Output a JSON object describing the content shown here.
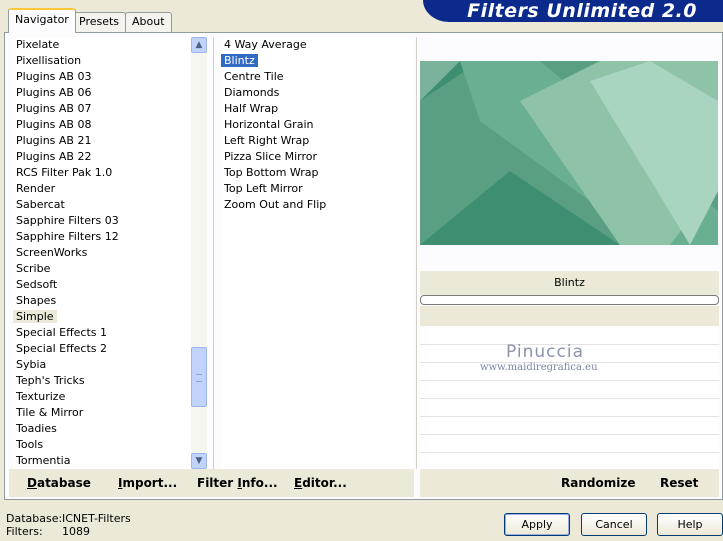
{
  "header": {
    "tabs": [
      "Navigator",
      "Presets",
      "About"
    ],
    "active_tab": "Navigator",
    "brand": "Filters Unlimited 2.0"
  },
  "categories": {
    "items": [
      "Pixelate",
      "Pixellisation",
      "Plugins AB 03",
      "Plugins AB 06",
      "Plugins AB 07",
      "Plugins AB 08",
      "Plugins AB 21",
      "Plugins AB 22",
      "RCS Filter Pak 1.0",
      "Render",
      "Sabercat",
      "Sapphire Filters 03",
      "Sapphire Filters 12",
      "ScreenWorks",
      "Scribe",
      "Sedsoft",
      "Shapes",
      "Simple",
      "Special Effects 1",
      "Special Effects 2",
      "Sybia",
      "Teph's Tricks",
      "Texturize",
      "Tile & Mirror",
      "Toadies",
      "Tools",
      "Tormentia"
    ],
    "selected": "Simple"
  },
  "filters": {
    "items": [
      "4 Way Average",
      "Blintz",
      "Centre Tile",
      "Diamonds",
      "Half Wrap",
      "Horizontal Grain",
      "Left Right Wrap",
      "Pizza Slice Mirror",
      "Top Bottom Wrap",
      "Top Left Mirror",
      "Zoom Out and Flip"
    ],
    "selected": "Blintz"
  },
  "preview": {
    "filter_name": "Blintz",
    "progress": 0,
    "colors": [
      "#3e8f71",
      "#6aaf91",
      "#8ec3a8",
      "#a9d4c0"
    ]
  },
  "watermark": {
    "name": "Pinuccia",
    "url": "www.maidiregrafica.eu"
  },
  "toolbar": {
    "database_prefix": "D",
    "database_rest": "atabase",
    "import_prefix": "I",
    "import_rest": "mport...",
    "filterinfo_prefix": "Filter ",
    "filterinfo_u": "I",
    "filterinfo_rest": "nfo...",
    "editor_prefix": "E",
    "editor_rest": "ditor...",
    "randomize": "Randomize",
    "reset": "Reset"
  },
  "status": {
    "database_label": "Database:",
    "database_value": "ICNET-Filters",
    "filters_label": "Filters:",
    "filters_value": "1089"
  },
  "buttons": {
    "apply": "Apply",
    "cancel": "Cancel",
    "help": "Help"
  }
}
